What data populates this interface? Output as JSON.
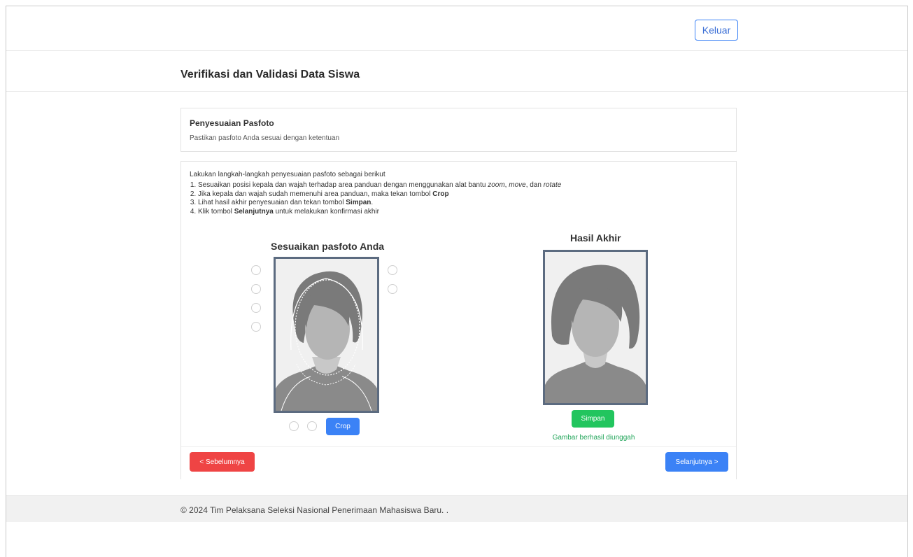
{
  "header": {
    "logout_label": "Keluar"
  },
  "page": {
    "title": "Verifikasi dan Validasi Data Siswa"
  },
  "intro_card": {
    "title": "Penyesuaian Pasfoto",
    "subtitle": "Pastikan pasfoto Anda sesuai dengan ketentuan"
  },
  "instructions": {
    "intro": "Lakukan langkah-langkah penyesuaian pasfoto sebagai berikut",
    "step1": {
      "text": "Sesuaikan posisi kepala dan wajah terhadap area panduan dengan menggunakan alat bantu ",
      "zoom": "zoom",
      "sep1": ", ",
      "move": "move",
      "sep2": ", dan ",
      "rotate": "rotate"
    },
    "step2": {
      "text": "Jika kepala dan wajah sudah memenuhi area panduan, maka tekan tombol ",
      "bold": "Crop"
    },
    "step3": {
      "text": "Lihat hasil akhir penyesuaian dan tekan tombol ",
      "bold": "Simpan",
      "after": "."
    },
    "step4": {
      "before": "Klik tombol ",
      "bold": "Selanjutnya",
      "after": " untuk melakukan konfirmasi akhir"
    }
  },
  "editor": {
    "title": "Sesuaikan pasfoto Anda",
    "crop_label": "Crop",
    "left_tool_icons": [
      "zoom-in-icon",
      "zoom-out-icon",
      "rotate-left-icon",
      "rotate-right-icon"
    ],
    "right_tool_icons": [
      "move-icon",
      "reset-icon"
    ],
    "bottom_tool_icons": [
      "flip-horizontal-icon",
      "flip-vertical-icon"
    ]
  },
  "result": {
    "title": "Hasil Akhir",
    "save_label": "Simpan",
    "status": "Gambar berhasil diunggah"
  },
  "nav": {
    "prev_label": "< Sebelumnya",
    "next_label": "Selanjutnya >"
  },
  "footer": {
    "text": "© 2024 Tim Pelaksana Seleksi Nasional Penerimaan Mahasiswa Baru.  ."
  },
  "colors": {
    "primary": "#3b82f6",
    "success": "#22c55e",
    "danger": "#ef4444",
    "frame_border": "#5c6b80",
    "success_text": "#22a55a"
  }
}
